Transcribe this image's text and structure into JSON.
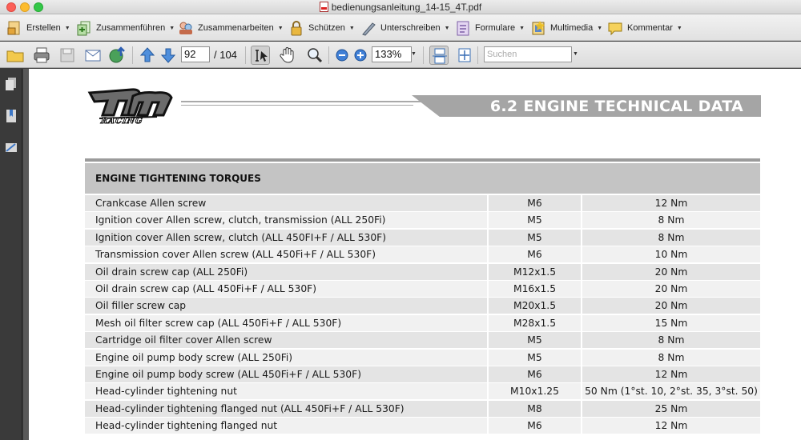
{
  "window": {
    "title": "bedienungsanleitung_14-15_4T.pdf"
  },
  "toolbar": {
    "items": [
      {
        "label": "Erstellen",
        "icon": "create-pdf-icon"
      },
      {
        "label": "Zusammenführen",
        "icon": "combine-icon"
      },
      {
        "label": "Zusammenarbeiten",
        "icon": "collaborate-icon"
      },
      {
        "label": "Schützen",
        "icon": "lock-icon"
      },
      {
        "label": "Unterschreiben",
        "icon": "pen-icon"
      },
      {
        "label": "Formulare",
        "icon": "form-icon"
      },
      {
        "label": "Multimedia",
        "icon": "film-icon"
      },
      {
        "label": "Kommentar",
        "icon": "comment-icon"
      }
    ]
  },
  "nav": {
    "page_number": "92",
    "page_total": "/ 104",
    "zoom": "133%",
    "search_placeholder": "Suchen"
  },
  "document": {
    "logo_text": "RACING",
    "header_title": "6.2 ENGINE TECHNICAL DATA",
    "section_title": "ENGINE TIGHTENING TORQUES",
    "rows": [
      {
        "desc": "Crankcase Allen screw",
        "size": "M6",
        "torque": "12 Nm"
      },
      {
        "desc": "Ignition cover Allen screw, clutch, transmission (ALL 250Fi)",
        "size": "M5",
        "torque": "8 Nm"
      },
      {
        "desc": "Ignition cover Allen screw, clutch (ALL 450FI+F / ALL 530F)",
        "size": "M5",
        "torque": "8 Nm"
      },
      {
        "desc": "Transmission cover Allen screw (ALL 450Fi+F / ALL 530F)",
        "size": "M6",
        "torque": "10 Nm"
      },
      {
        "desc": "Oil drain screw cap (ALL 250Fi)",
        "size": "M12x1.5",
        "torque": "20 Nm"
      },
      {
        "desc": "Oil drain screw cap (ALL 450Fi+F / ALL 530F)",
        "size": "M16x1.5",
        "torque": "20 Nm"
      },
      {
        "desc": "Oil filler screw cap",
        "size": "M20x1.5",
        "torque": "20 Nm"
      },
      {
        "desc": "Mesh oil filter screw cap (ALL 450Fi+F / ALL 530F)",
        "size": "M28x1.5",
        "torque": "15 Nm"
      },
      {
        "desc": "Cartridge oil filter cover Allen screw",
        "size": "M5",
        "torque": "8 Nm"
      },
      {
        "desc": "Engine oil pump body screw (ALL 250Fi)",
        "size": "M5",
        "torque": "8 Nm"
      },
      {
        "desc": "Engine oil pump body screw (ALL 450Fi+F / ALL 530F)",
        "size": "M6",
        "torque": "12 Nm"
      },
      {
        "desc": "Head-cylinder tightening nut",
        "size": "M10x1.25",
        "torque": "50 Nm (1°st. 10, 2°st. 35, 3°st. 50)"
      },
      {
        "desc": "Head-cylinder tightening flanged nut (ALL 450Fi+F / ALL 530F)",
        "size": "M8",
        "torque": "25 Nm"
      },
      {
        "desc": "Head-cylinder tightening flanged nut",
        "size": "M6",
        "torque": "12 Nm"
      }
    ]
  }
}
